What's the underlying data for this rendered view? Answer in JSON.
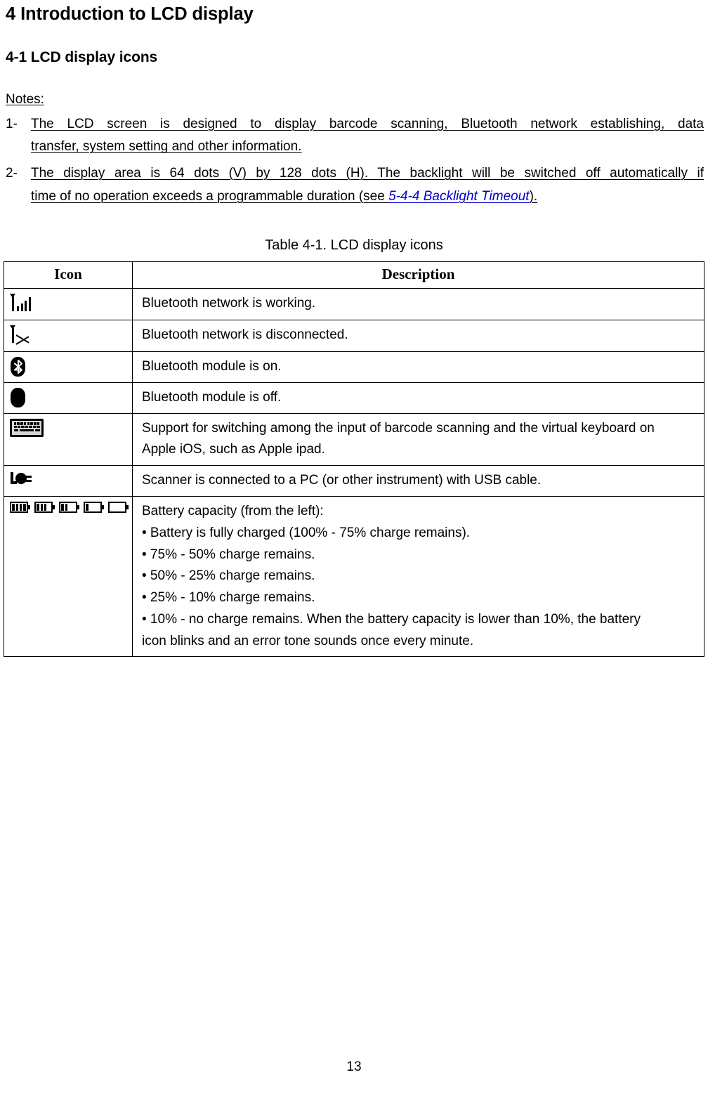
{
  "document": {
    "chapter_heading": "4 Introduction to LCD display",
    "section_heading": "4-1 LCD display icons",
    "page_number": "13"
  },
  "notes": {
    "label": "Notes:",
    "items": [
      {
        "number": "1-",
        "line1": "The LCD screen is designed to display barcode scanning, Bluetooth network establishing, data",
        "line2": "transfer, system setting and other information.",
        "line2_tail": "",
        "xref": "",
        "xref_tail": ""
      },
      {
        "number": "2-",
        "line1": "The display area is 64 dots (V) by 128 dots (H). The backlight will be switched off automatically if",
        "line2": "time of no operation exceeds a programmable duration (see ",
        "line2_tail": "",
        "xref": "5-4-4 Backlight Timeout",
        "xref_tail": ")."
      }
    ]
  },
  "table": {
    "caption": "Table 4-1. LCD display icons",
    "headers": {
      "icon": "Icon",
      "description": "Description"
    },
    "rows": [
      {
        "icon_name": "bluetooth-signal-working-icon",
        "lines": [
          "Bluetooth network is working."
        ]
      },
      {
        "icon_name": "bluetooth-signal-disconnected-icon",
        "lines": [
          "Bluetooth network is disconnected."
        ]
      },
      {
        "icon_name": "bluetooth-module-on-icon",
        "lines": [
          "Bluetooth module is on."
        ]
      },
      {
        "icon_name": "bluetooth-module-off-icon",
        "lines": [
          "Bluetooth module is off."
        ]
      },
      {
        "icon_name": "virtual-keyboard-icon",
        "lines": [
          "Support for switching among the input of barcode scanning and the virtual keyboard on",
          "Apple iOS, such as Apple ipad."
        ]
      },
      {
        "icon_name": "usb-plug-icon",
        "lines": [
          "Scanner is connected to a PC (or other instrument) with USB cable."
        ]
      },
      {
        "icon_name": "battery-capacity-icons",
        "lines": [
          "Battery capacity (from the left):",
          "• Battery is fully charged (100% - 75% charge remains).",
          "• 75% - 50% charge remains.",
          "• 50% - 25% charge remains.",
          "• 25% - 10% charge remains.",
          "• 10% - no charge remains. When the battery capacity is lower than 10%, the battery",
          "icon blinks and an error tone sounds once every minute."
        ]
      }
    ],
    "battery_levels": [
      4,
      3,
      2,
      1,
      0
    ]
  },
  "colors": {
    "text": "#000000",
    "hyperlink": "#0000cc",
    "border": "#000000",
    "background": "#ffffff"
  }
}
